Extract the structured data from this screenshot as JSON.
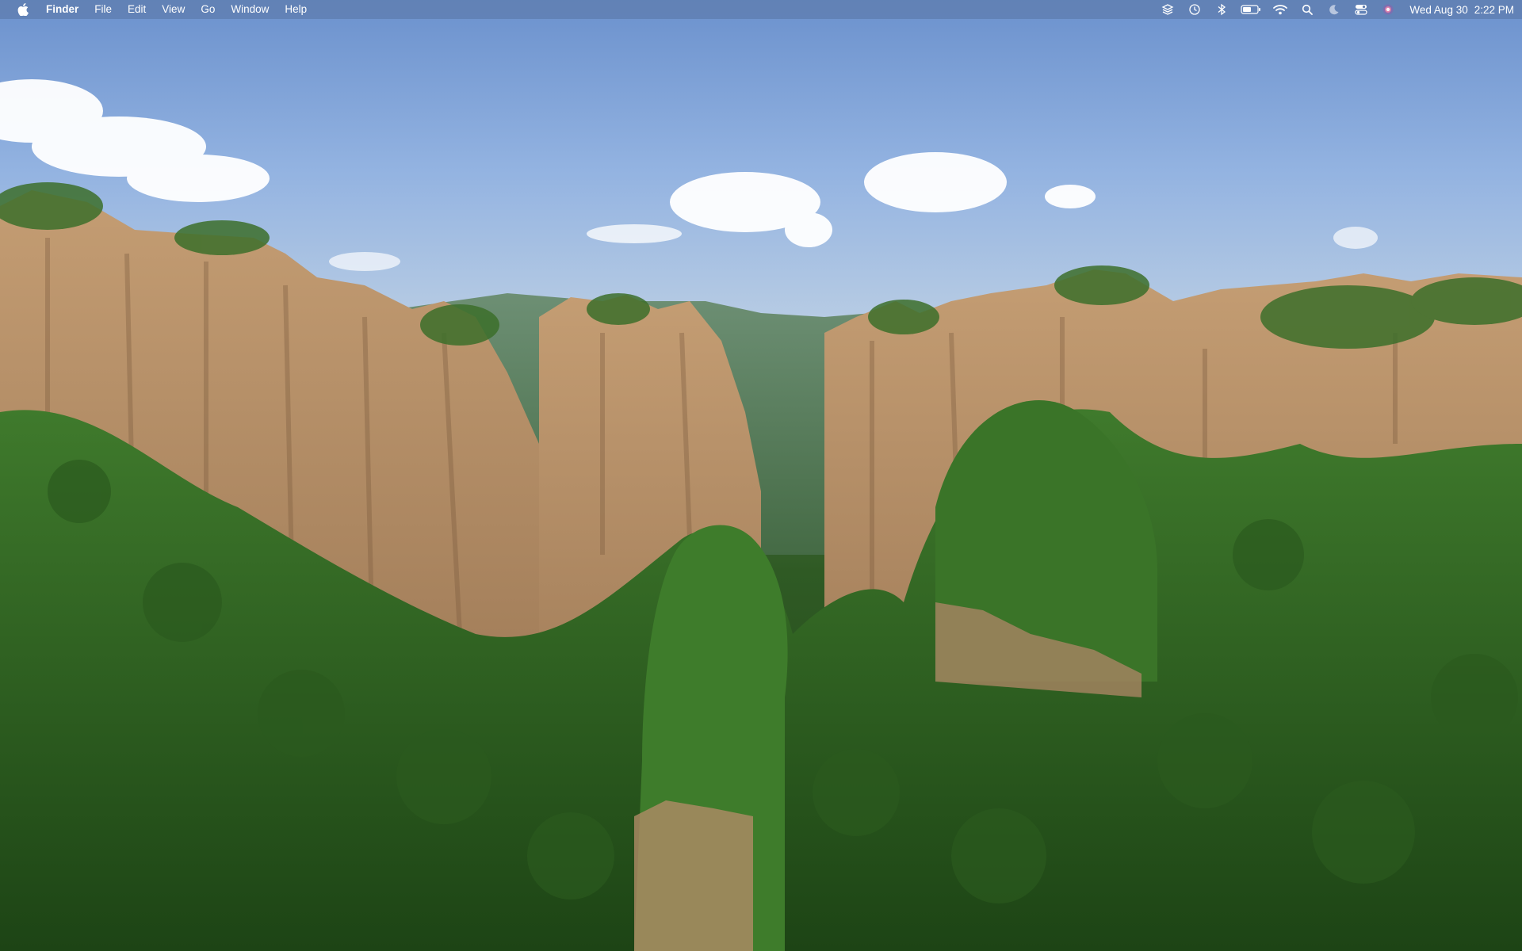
{
  "menubar": {
    "apple_icon": "apple-logo-icon",
    "app_name": "Finder",
    "menus": [
      "File",
      "Edit",
      "View",
      "Go",
      "Window",
      "Help"
    ],
    "status_icons": [
      "layers-icon",
      "time-machine-icon",
      "bluetooth-icon",
      "battery-icon",
      "wifi-icon",
      "search-icon",
      "do-not-disturb-moon-icon",
      "control-center-icon",
      "siri-icon"
    ],
    "date": "Wed Aug 30",
    "time": "2:22 PM"
  },
  "wallpaper": {
    "description_colors": {
      "sky_top": "#6f94cf",
      "sky_horizon": "#b8cce2",
      "forest": "#2f5a24",
      "rock": "#b8926a"
    }
  }
}
